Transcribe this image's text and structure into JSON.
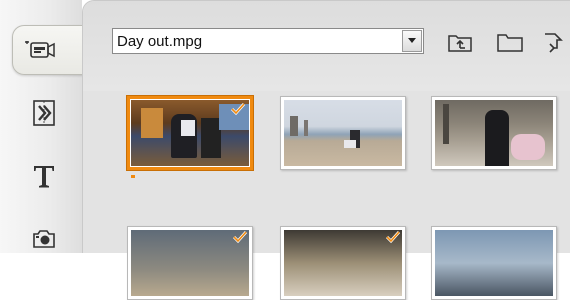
{
  "file_select": {
    "value": "Day out.mpg"
  },
  "toolbar": {
    "icons": [
      "parent-folder-icon",
      "folder-icon",
      "import-arrow-icon"
    ]
  },
  "tabs": [
    {
      "name": "video-tab",
      "icon": "video-camera-icon",
      "active": true
    },
    {
      "name": "transitions-tab",
      "icon": "transition-icon",
      "active": false
    },
    {
      "name": "titles-tab",
      "icon": "title-t-icon",
      "active": false
    },
    {
      "name": "photos-tab",
      "icon": "photo-camera-icon",
      "active": false
    }
  ],
  "colors": {
    "accent": "#f08a10",
    "panel": "#e3e3e3"
  },
  "thumbnails": [
    {
      "id": "scene-1",
      "selected": true,
      "checked": true
    },
    {
      "id": "scene-2",
      "selected": false,
      "checked": false
    },
    {
      "id": "scene-3",
      "selected": false,
      "checked": false
    },
    {
      "id": "scene-4",
      "selected": false,
      "checked": true
    },
    {
      "id": "scene-5",
      "selected": false,
      "checked": true
    },
    {
      "id": "scene-6",
      "selected": false,
      "checked": false
    }
  ]
}
